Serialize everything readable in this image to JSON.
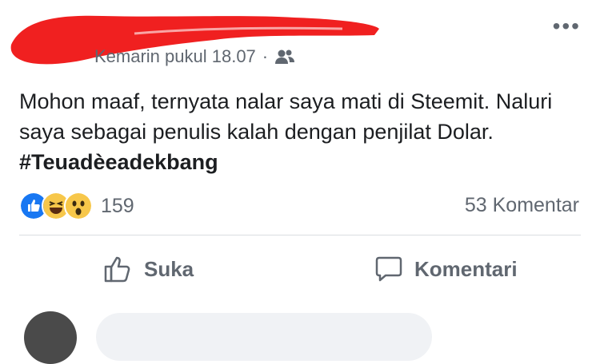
{
  "post": {
    "timestamp": "Kemarin pukul 18.07",
    "separator": "·",
    "audience_icon": "friends-icon",
    "more_label": "•••",
    "text_main": "Mohon maaf, ternyata nalar saya mati di Steemit. Naluri saya sebagai penulis kalah dengan penjilat Dolar. ",
    "hashtag": "#Teuadèeadekbang"
  },
  "reactions": {
    "icons": [
      "like-reaction-icon",
      "haha-reaction-icon",
      "wow-reaction-icon"
    ],
    "count": "159",
    "comments": "53 Komentar"
  },
  "actions": {
    "like_label": "Suka",
    "comment_label": "Komentari"
  },
  "colors": {
    "redaction": "#f02020",
    "like_blue": "#1877f2",
    "emoji_yellow": "#f7c74a",
    "meta_gray": "#606770"
  }
}
